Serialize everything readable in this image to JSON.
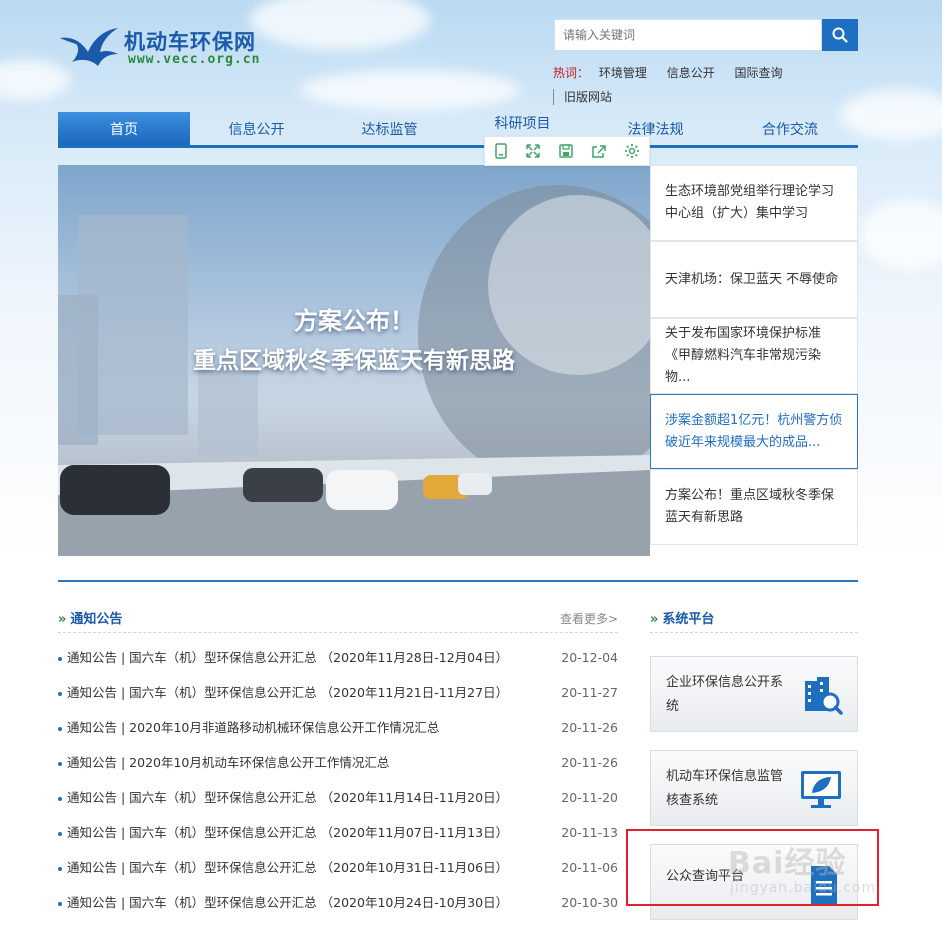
{
  "header": {
    "logo_name": "机动车环保网",
    "logo_url": "www.vecc.org.cn",
    "search_placeholder": "请输入关键词",
    "hot_label": "热词：",
    "hot_words": [
      "环境管理",
      "信息公开",
      "国际查询"
    ],
    "old_site": "旧版网站"
  },
  "nav": {
    "items": [
      "首页",
      "信息公开",
      "达标监管",
      "科研项目",
      "法律法规",
      "合作交流"
    ],
    "active_index": 0
  },
  "banner": {
    "line1": "方案公布！",
    "line2": "重点区域秋冬季保蓝天有新思路"
  },
  "news": [
    {
      "text": "生态环境部党组举行理论学习中心组（扩大）集中学习",
      "active": false
    },
    {
      "text": "天津机场：保卫蓝天 不辱使命",
      "active": false
    },
    {
      "text": "关于发布国家环境保护标准《甲醇燃料汽车非常规污染物...",
      "active": false
    },
    {
      "text": "涉案金额超1亿元！杭州警方侦破近年来规模最大的成品...",
      "active": true
    },
    {
      "text": "方案公布！重点区域秋冬季保蓝天有新思路",
      "active": false
    }
  ],
  "notices_section": {
    "title": "通知公告",
    "more": "查看更多>",
    "items": [
      {
        "text": "通知公告 | 国六车（机）型环保信息公开汇总 （2020年11月28日-12月04日）",
        "date": "20-12-04"
      },
      {
        "text": "通知公告 | 国六车（机）型环保信息公开汇总 （2020年11月21日-11月27日）",
        "date": "20-11-27"
      },
      {
        "text": "通知公告 | 2020年10月非道路移动机械环保信息公开工作情况汇总",
        "date": "20-11-26"
      },
      {
        "text": "通知公告 | 2020年10月机动车环保信息公开工作情况汇总",
        "date": "20-11-26"
      },
      {
        "text": "通知公告 | 国六车（机）型环保信息公开汇总 （2020年11月14日-11月20日）",
        "date": "20-11-20"
      },
      {
        "text": "通知公告 | 国六车（机）型环保信息公开汇总 （2020年11月07日-11月13日）",
        "date": "20-11-13"
      },
      {
        "text": "通知公告 | 国六车（机）型环保信息公开汇总 （2020年10月31日-11月06日）",
        "date": "20-11-06"
      },
      {
        "text": "通知公告 | 国六车（机）型环保信息公开汇总 （2020年10月24日-10月30日）",
        "date": "20-10-30"
      }
    ]
  },
  "platform_section": {
    "title": "系统平台",
    "items": [
      {
        "label": "企业环保信息公开系统",
        "icon": "building-search-icon"
      },
      {
        "label": "机动车环保信息监管核查系统",
        "icon": "monitor-leaf-icon"
      },
      {
        "label": "公众查询平台",
        "icon": "document-icon"
      }
    ]
  },
  "watermark": {
    "text": "Bai经验",
    "sub": "jingyan.baidu.com"
  },
  "colors": {
    "primary": "#1f6fc0",
    "green": "#2c8a3c",
    "hot_red": "#c8161d",
    "highlight": "#e4202a"
  }
}
